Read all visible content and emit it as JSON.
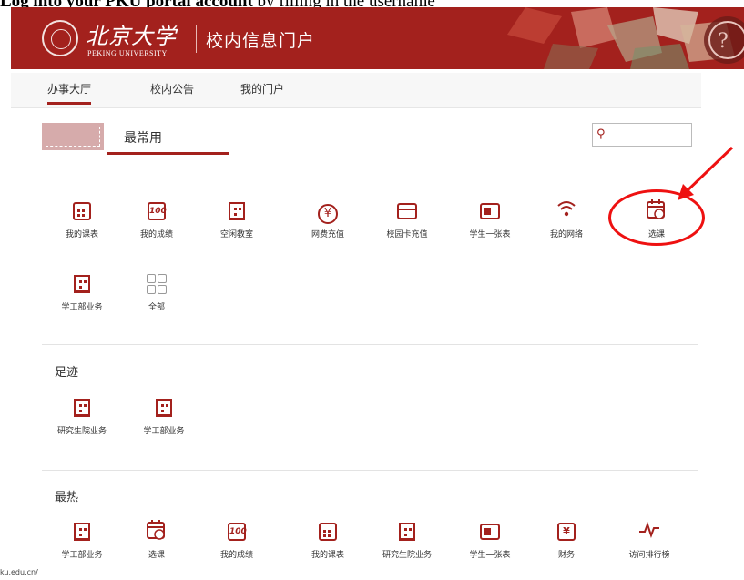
{
  "caption": {
    "bold": "Log into your PKU portal account",
    "rest": " by filling in the username"
  },
  "header": {
    "logo_name": "北京大学",
    "logo_en": "PEKING UNIVERSITY",
    "portal_title": "校内信息门户",
    "accent_color": "#a3211d"
  },
  "nav": {
    "tabs": [
      {
        "label": "办事大厅",
        "active": true
      },
      {
        "label": "校内公告"
      },
      {
        "label": "我的门户"
      }
    ]
  },
  "favorites": {
    "label": "最常用",
    "items": [
      {
        "label": "我的课表",
        "icon": "calendar-grid-icon"
      },
      {
        "label": "我的成绩",
        "icon": "grade-100-icon"
      },
      {
        "label": "空闲教室",
        "icon": "building-icon"
      },
      {
        "label": "网费充值",
        "icon": "yen-coin-icon"
      },
      {
        "label": "校园卡充值",
        "icon": "card-icon"
      },
      {
        "label": "学生一张表",
        "icon": "id-card-icon"
      },
      {
        "label": "我的网络",
        "icon": "wifi-icon"
      },
      {
        "label": "选课",
        "icon": "course-select-icon"
      },
      {
        "label": "学工部业务",
        "icon": "building-icon"
      },
      {
        "label": "全部",
        "icon": "all-grid-icon"
      }
    ]
  },
  "footprints": {
    "label": "足迹",
    "items": [
      {
        "label": "研究生院业务",
        "icon": "building-icon"
      },
      {
        "label": "学工部业务",
        "icon": "building-icon"
      }
    ]
  },
  "hottest": {
    "label": "最热",
    "items": [
      {
        "label": "学工部业务",
        "icon": "building-icon"
      },
      {
        "label": "选课",
        "icon": "course-select-icon"
      },
      {
        "label": "我的成绩",
        "icon": "grade-100-icon"
      },
      {
        "label": "我的课表",
        "icon": "calendar-grid-icon"
      },
      {
        "label": "研究生院业务",
        "icon": "building-icon"
      },
      {
        "label": "学生一张表",
        "icon": "id-card-icon"
      },
      {
        "label": "财务",
        "icon": "finance-icon"
      },
      {
        "label": "访问排行榜",
        "icon": "pulse-icon"
      }
    ]
  },
  "status_bar": {
    "url": "ku.edu.cn/"
  }
}
